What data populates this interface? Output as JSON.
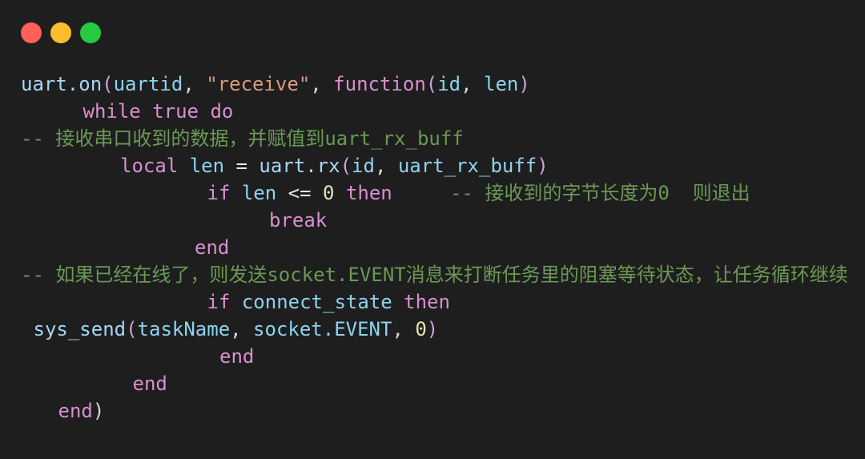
{
  "window": {
    "background_color": "#1e1e1e",
    "titlebar": {
      "buttons": [
        {
          "name": "close",
          "label": "",
          "color": "#ff5f56"
        },
        {
          "name": "minimize",
          "label": "",
          "color": "#ffbd2e"
        },
        {
          "name": "maximize",
          "label": "",
          "color": "#27c93f"
        }
      ]
    }
  },
  "editor": {
    "language": "lua",
    "font_size_px": 24,
    "colors": {
      "background": "#1e1e1e",
      "function": "#a6d7f5",
      "identifier": "#8ed3ef",
      "keyword": "#d98fd0",
      "punctuation": "#c8a2e0",
      "string": "#d99a7e",
      "number": "#e4e4b4",
      "operator": "#e8e8e8",
      "comment": "#6a9955"
    },
    "lines": [
      {
        "id": "line-1",
        "indent": 0,
        "tokens": [
          {
            "t": "fn",
            "v": "uart.on"
          },
          {
            "t": "punct",
            "v": "("
          },
          {
            "t": "ident",
            "v": "uartid"
          },
          {
            "t": "punct2",
            "v": ","
          },
          {
            "t": "plain",
            "v": " "
          },
          {
            "t": "str",
            "v": "\"receive\""
          },
          {
            "t": "punct2",
            "v": ","
          },
          {
            "t": "plain",
            "v": " "
          },
          {
            "t": "kw",
            "v": "function"
          },
          {
            "t": "punct",
            "v": "("
          },
          {
            "t": "ident",
            "v": "id"
          },
          {
            "t": "punct2",
            "v": ","
          },
          {
            "t": "plain",
            "v": " "
          },
          {
            "t": "ident",
            "v": "len"
          },
          {
            "t": "punct",
            "v": ")"
          }
        ]
      },
      {
        "id": "line-2",
        "indent": 5,
        "tokens": [
          {
            "t": "kw",
            "v": "while"
          },
          {
            "t": "plain",
            "v": " "
          },
          {
            "t": "kw",
            "v": "true"
          },
          {
            "t": "plain",
            "v": " "
          },
          {
            "t": "kw",
            "v": "do"
          }
        ]
      },
      {
        "id": "line-3",
        "indent": 0,
        "tokens": [
          {
            "t": "comment",
            "v": "-- 接收串口收到的数据，并赋值到uart_rx_buff"
          }
        ]
      },
      {
        "id": "line-4",
        "indent": 8,
        "tokens": [
          {
            "t": "kw",
            "v": "local"
          },
          {
            "t": "plain",
            "v": " "
          },
          {
            "t": "ident",
            "v": "len"
          },
          {
            "t": "plain",
            "v": " "
          },
          {
            "t": "op",
            "v": "="
          },
          {
            "t": "plain",
            "v": " "
          },
          {
            "t": "fn",
            "v": "uart.rx"
          },
          {
            "t": "punct",
            "v": "("
          },
          {
            "t": "ident",
            "v": "id"
          },
          {
            "t": "punct2",
            "v": ","
          },
          {
            "t": "plain",
            "v": " "
          },
          {
            "t": "ident",
            "v": "uart_rx_buff"
          },
          {
            "t": "punct",
            "v": ")"
          }
        ]
      },
      {
        "id": "line-5",
        "indent": 15,
        "tokens": [
          {
            "t": "kw",
            "v": "if"
          },
          {
            "t": "plain",
            "v": " "
          },
          {
            "t": "ident",
            "v": "len"
          },
          {
            "t": "plain",
            "v": " "
          },
          {
            "t": "op",
            "v": "<="
          },
          {
            "t": "plain",
            "v": " "
          },
          {
            "t": "num",
            "v": "0"
          },
          {
            "t": "plain",
            "v": " "
          },
          {
            "t": "kw",
            "v": "then"
          },
          {
            "t": "plain",
            "v": "     "
          },
          {
            "t": "comment",
            "v": "-- 接收到的字节长度为0  则退出"
          }
        ]
      },
      {
        "id": "line-6",
        "indent": 20,
        "tokens": [
          {
            "t": "kw",
            "v": "break"
          }
        ]
      },
      {
        "id": "line-7",
        "indent": 14,
        "tokens": [
          {
            "t": "kw",
            "v": "end"
          }
        ]
      },
      {
        "id": "line-8",
        "indent": 0,
        "wrap": true,
        "tokens": [
          {
            "t": "comment",
            "v": "-- 如果已经在线了，则发送socket.EVENT消息来打断任务里的阻塞等待状态，让任务循环继续"
          }
        ]
      },
      {
        "id": "line-9",
        "indent": 15,
        "tokens": [
          {
            "t": "kw",
            "v": "if"
          },
          {
            "t": "plain",
            "v": " "
          },
          {
            "t": "ident",
            "v": "connect_state"
          },
          {
            "t": "plain",
            "v": " "
          },
          {
            "t": "kw",
            "v": "then"
          }
        ]
      },
      {
        "id": "line-10",
        "indent": 1,
        "tokens": [
          {
            "t": "fn",
            "v": "sys_send"
          },
          {
            "t": "punct",
            "v": "("
          },
          {
            "t": "ident",
            "v": "taskName"
          },
          {
            "t": "punct2",
            "v": ","
          },
          {
            "t": "plain",
            "v": " "
          },
          {
            "t": "ident",
            "v": "socket.EVENT"
          },
          {
            "t": "punct2",
            "v": ","
          },
          {
            "t": "plain",
            "v": " "
          },
          {
            "t": "num",
            "v": "0"
          },
          {
            "t": "punct",
            "v": ")"
          }
        ]
      },
      {
        "id": "line-11",
        "indent": 16,
        "tokens": [
          {
            "t": "kw",
            "v": "end"
          }
        ]
      },
      {
        "id": "line-12",
        "indent": 9,
        "tokens": [
          {
            "t": "kw",
            "v": "end"
          }
        ]
      },
      {
        "id": "line-13",
        "indent": 3,
        "tokens": [
          {
            "t": "kw",
            "v": "end"
          },
          {
            "t": "punct2",
            "v": ")"
          }
        ]
      }
    ]
  }
}
